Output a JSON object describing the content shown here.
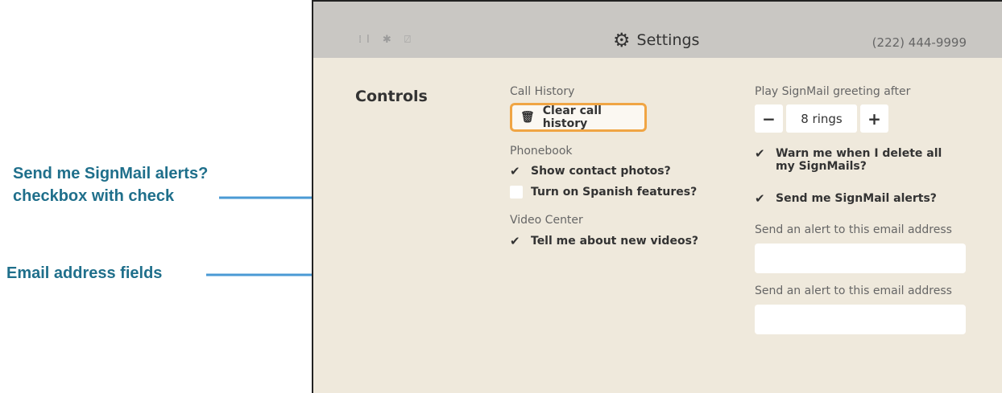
{
  "callouts": {
    "alerts_line1": "Send me SignMail alerts?",
    "alerts_line2": "checkbox with check",
    "email": "Email address fields"
  },
  "colors": {
    "callout_text": "#1f6f8b",
    "arrow": "#4a9ad4",
    "focus_outline": "#f0a544"
  },
  "header": {
    "status_icons": [
      "signal-icon",
      "bluetooth-icon",
      "video-off-icon"
    ],
    "title": "Settings",
    "phone": "(222) 444-9999"
  },
  "controls": {
    "section_label": "Controls"
  },
  "call_history": {
    "label": "Call History",
    "clear_button": "Clear call history"
  },
  "phonebook": {
    "label": "Phonebook",
    "options": [
      {
        "label": "Show contact photos?",
        "checked": true
      },
      {
        "label": "Turn on Spanish features?",
        "checked": false
      }
    ]
  },
  "video_center": {
    "label": "Video Center",
    "option": {
      "label": "Tell me about new videos?",
      "checked": true
    }
  },
  "signmail": {
    "greeting_label": "Play SignMail greeting after",
    "rings_value": "8 rings",
    "minus": "−",
    "plus": "+",
    "warn_label_line1": "Warn me when I delete all",
    "warn_label_line2": "my SignMails?",
    "alerts_label": "Send me SignMail alerts?",
    "email_label_1": "Send an alert to this email address",
    "email_label_2": "Send an alert to this email address",
    "email_value_1": "",
    "email_value_2": ""
  }
}
